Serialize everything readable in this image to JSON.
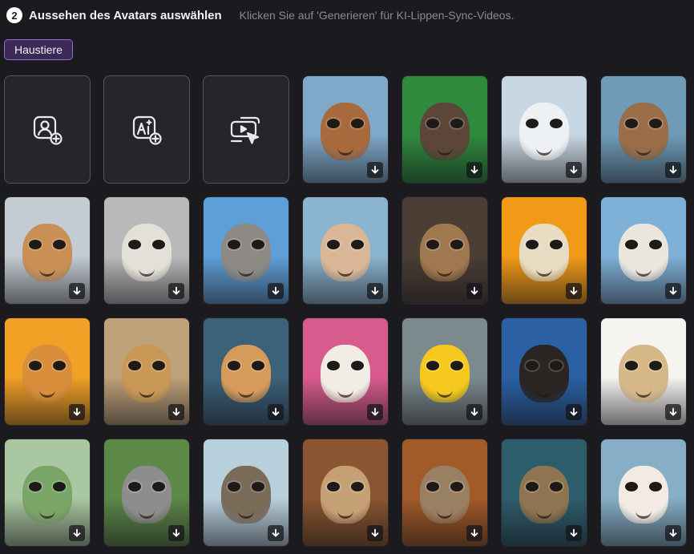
{
  "header": {
    "step": "2",
    "title": "Aussehen des Avatars auswählen",
    "hint": "Klicken Sie auf 'Generieren' für KI-Lippen-Sync-Videos."
  },
  "filter": {
    "label": "Haustiere"
  },
  "actions": [
    {
      "name": "upload-photo-avatar-button",
      "icon": "user-portrait-add-icon"
    },
    {
      "name": "ai-generate-avatar-button",
      "icon": "ai-image-add-icon"
    },
    {
      "name": "video-avatar-button",
      "icon": "video-cursor-icon"
    }
  ],
  "avatars": [
    {
      "name": "highland-cow-sunglasses",
      "bg": "#7fa8c9",
      "face": "#a86a3c"
    },
    {
      "name": "chimpanzee-cap",
      "bg": "#2f8a3e",
      "face": "#5b4638"
    },
    {
      "name": "baby-seal",
      "bg": "#c7d7e4",
      "face": "#eef1f3"
    },
    {
      "name": "capybara-flower-crown",
      "bg": "#6f9bb8",
      "face": "#9a6d48"
    },
    {
      "name": "giraffe",
      "bg": "#c3ccd2",
      "face": "#c98f54"
    },
    {
      "name": "spotted-gecko",
      "bg": "#b9b9b9",
      "face": "#e3e0d8"
    },
    {
      "name": "donkey",
      "bg": "#5f9fd8",
      "face": "#8d8a86"
    },
    {
      "name": "bunny-hat-sunglasses",
      "bg": "#8bb4cf",
      "face": "#d9b796"
    },
    {
      "name": "baby-monkey",
      "bg": "#4a3e35",
      "face": "#a07850"
    },
    {
      "name": "sheep-orange-glasses",
      "bg": "#f29a18",
      "face": "#e8dcc2"
    },
    {
      "name": "goat-sunglasses",
      "bg": "#7fb0d8",
      "face": "#ebe6dc"
    },
    {
      "name": "cat-sunglasses",
      "bg": "#f0a126",
      "face": "#d98e3c"
    },
    {
      "name": "cheetah",
      "bg": "#bfa17a",
      "face": "#c99857"
    },
    {
      "name": "cat-bee-hat",
      "bg": "#3c627a",
      "face": "#d69a5a"
    },
    {
      "name": "llama-pink-glasses",
      "bg": "#d85b8d",
      "face": "#f1ece4"
    },
    {
      "name": "duckling",
      "bg": "#7c8a8e",
      "face": "#f4c81c"
    },
    {
      "name": "bernese-dog",
      "bg": "#2b61a4",
      "face": "#2a2422"
    },
    {
      "name": "hamster-yellow-hoodie",
      "bg": "#f6f4f1",
      "face": "#d6b888"
    },
    {
      "name": "turtle-hat-sunglasses",
      "bg": "#a9c7a0",
      "face": "#79a566"
    },
    {
      "name": "koala",
      "bg": "#5c8848",
      "face": "#8d8d8d"
    },
    {
      "name": "otter-beach",
      "bg": "#b8cfdc",
      "face": "#7a6a58"
    },
    {
      "name": "meerkat",
      "bg": "#8a5530",
      "face": "#c6a075"
    },
    {
      "name": "sloth",
      "bg": "#a25a28",
      "face": "#9a8062"
    },
    {
      "name": "owl-orange-hat",
      "bg": "#2d5c6b",
      "face": "#8e7450"
    },
    {
      "name": "white-cat",
      "bg": "#86aec6",
      "face": "#f3ebe3"
    }
  ]
}
